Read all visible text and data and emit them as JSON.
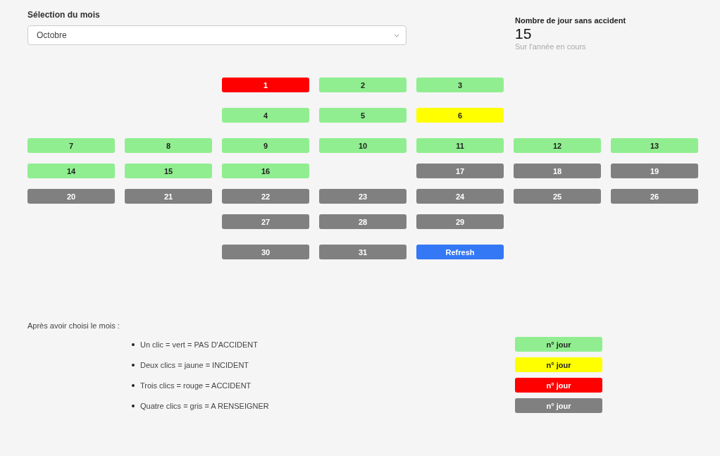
{
  "month_select": {
    "label": "Sélection du mois",
    "value": "Octobre"
  },
  "counter": {
    "title": "Nombre de jour sans accident",
    "value": "15",
    "subtitle": "Sur l'année en cours"
  },
  "calendar": {
    "rows": [
      [
        null,
        null,
        {
          "label": "1",
          "kind": "day",
          "color": "#ff0000"
        },
        {
          "label": "2",
          "kind": "day",
          "color": "#90ee90"
        },
        {
          "label": "3",
          "kind": "day",
          "color": "#90ee90"
        },
        null,
        null
      ],
      [
        null,
        null,
        {
          "label": "4",
          "kind": "day",
          "color": "#90ee90"
        },
        {
          "label": "5",
          "kind": "day",
          "color": "#90ee90"
        },
        {
          "label": "6",
          "kind": "day",
          "color": "#ffff00"
        },
        null,
        null
      ],
      [
        {
          "label": "7",
          "kind": "day",
          "color": "#90ee90"
        },
        {
          "label": "8",
          "kind": "day",
          "color": "#90ee90"
        },
        {
          "label": "9",
          "kind": "day",
          "color": "#90ee90"
        },
        {
          "label": "10",
          "kind": "day",
          "color": "#90ee90"
        },
        {
          "label": "11",
          "kind": "day",
          "color": "#90ee90"
        },
        {
          "label": "12",
          "kind": "day",
          "color": "#90ee90"
        },
        {
          "label": "13",
          "kind": "day",
          "color": "#90ee90"
        }
      ],
      [
        {
          "label": "14",
          "kind": "day",
          "color": "#90ee90"
        },
        {
          "label": "15",
          "kind": "day",
          "color": "#90ee90"
        },
        {
          "label": "16",
          "kind": "day",
          "color": "#90ee90"
        },
        null,
        {
          "label": "17",
          "kind": "day",
          "color": "#808080"
        },
        {
          "label": "18",
          "kind": "day",
          "color": "#808080"
        },
        {
          "label": "19",
          "kind": "day",
          "color": "#808080"
        }
      ],
      [
        {
          "label": "20",
          "kind": "day",
          "color": "#808080"
        },
        {
          "label": "21",
          "kind": "day",
          "color": "#808080"
        },
        {
          "label": "22",
          "kind": "day",
          "color": "#808080"
        },
        {
          "label": "23",
          "kind": "day",
          "color": "#808080"
        },
        {
          "label": "24",
          "kind": "day",
          "color": "#808080"
        },
        {
          "label": "25",
          "kind": "day",
          "color": "#808080"
        },
        {
          "label": "26",
          "kind": "day",
          "color": "#808080"
        }
      ],
      [
        null,
        null,
        {
          "label": "27",
          "kind": "day",
          "color": "#808080"
        },
        {
          "label": "28",
          "kind": "day",
          "color": "#808080"
        },
        {
          "label": "29",
          "kind": "day",
          "color": "#808080"
        },
        null,
        null
      ],
      [
        null,
        null,
        {
          "label": "30",
          "kind": "day",
          "color": "#808080"
        },
        {
          "label": "31",
          "kind": "day",
          "color": "#808080"
        },
        {
          "label": "Refresh",
          "kind": "refresh"
        },
        null,
        null
      ]
    ]
  },
  "legend": {
    "intro": "Après avoir choisi le mois :",
    "items": [
      {
        "text": "Un clic = vert = PAS D'ACCIDENT",
        "sample": "n° jour",
        "color": "#90ee90"
      },
      {
        "text": "Deux clics = jaune = INCIDENT",
        "sample": "n° jour",
        "color": "#ffff00"
      },
      {
        "text": "Trois clics = rouge = ACCIDENT",
        "sample": "n° jour",
        "color": "#ff0000"
      },
      {
        "text": "Quatre clics = gris = A RENSEIGNER",
        "sample": "n° jour",
        "color": "#808080"
      }
    ]
  }
}
